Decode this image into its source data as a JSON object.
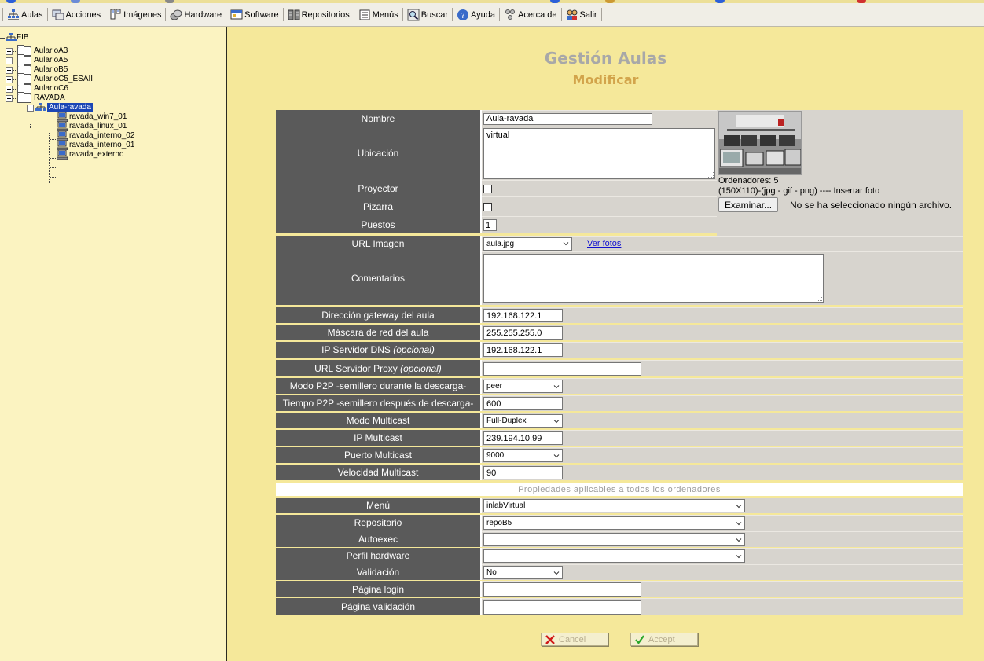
{
  "menubar": {
    "items": [
      {
        "label": "Aulas",
        "icon": "aulas-icon"
      },
      {
        "label": "Acciones",
        "icon": "acciones-icon"
      },
      {
        "label": "Imágenes",
        "icon": "imagenes-icon"
      },
      {
        "label": "Hardware",
        "icon": "hardware-icon"
      },
      {
        "label": "Software",
        "icon": "software-icon"
      },
      {
        "label": "Repositorios",
        "icon": "repositorios-icon"
      },
      {
        "label": "Menús",
        "icon": "menus-icon"
      },
      {
        "label": "Buscar",
        "icon": "buscar-icon"
      },
      {
        "label": "Ayuda",
        "icon": "ayuda-icon"
      },
      {
        "label": "Acerca de",
        "icon": "acerca-icon"
      },
      {
        "label": "Salir",
        "icon": "salir-icon"
      }
    ]
  },
  "tree": {
    "root": "FIB",
    "folders": [
      "AularioA3",
      "AularioA5",
      "AularioB5",
      "AularioC5_ESAII",
      "AularioC6",
      "RAVADA"
    ],
    "selected": "Aula-ravada",
    "computers": [
      "ravada_win7_01",
      "ravada_linux_01",
      "ravada_interno_02",
      "ravada_interno_01",
      "ravada_externo"
    ]
  },
  "header": {
    "title": "Gestión Aulas",
    "subtitle": "Modificar"
  },
  "form": {
    "nombre": {
      "label": "Nombre",
      "value": "Aula-ravada"
    },
    "ubicacion": {
      "label": "Ubicación",
      "value": "virtual"
    },
    "proyector": {
      "label": "Proyector",
      "checked": false
    },
    "pizarra": {
      "label": "Pizarra",
      "checked": false
    },
    "puestos": {
      "label": "Puestos",
      "value": "1"
    },
    "url_imagen": {
      "label": "URL Imagen",
      "value": "aula.jpg",
      "link": "Ver fotos"
    },
    "comentarios": {
      "label": "Comentarios",
      "value": ""
    },
    "gateway": {
      "label": "Dirección gateway del aula",
      "value": "192.168.122.1"
    },
    "mascara": {
      "label": "Máscara de red del aula",
      "value": "255.255.255.0"
    },
    "dns": {
      "label": "IP Servidor DNS",
      "optional": "(opcional)",
      "value": "192.168.122.1"
    },
    "proxy": {
      "label": "URL Servidor Proxy",
      "optional": "(opcional)",
      "value": ""
    },
    "p2p_modo": {
      "label": "Modo P2P -semillero durante la descarga-",
      "value": "peer"
    },
    "p2p_tiempo": {
      "label": "Tiempo P2P -semillero después de descarga-",
      "value": "600"
    },
    "mc_modo": {
      "label": "Modo Multicast",
      "value": "Full-Duplex"
    },
    "mc_ip": {
      "label": "IP Multicast",
      "value": "239.194.10.99"
    },
    "mc_puerto": {
      "label": "Puerto Multicast",
      "value": "9000"
    },
    "mc_velocidad": {
      "label": "Velocidad Multicast",
      "value": "90"
    },
    "section_title": "Propiedades aplicables a todos los ordenadores",
    "menu": {
      "label": "Menú",
      "value": "inlabVirtual"
    },
    "repositorio": {
      "label": "Repositorio",
      "value": "repoB5"
    },
    "autoexec": {
      "label": "Autoexec",
      "value": ""
    },
    "perfil_hw": {
      "label": "Perfil hardware",
      "value": ""
    },
    "validacion": {
      "label": "Validación",
      "value": "No"
    },
    "pagina_login": {
      "label": "Página login",
      "value": ""
    },
    "pagina_validacion": {
      "label": "Página validación",
      "value": ""
    }
  },
  "photo": {
    "ordenadores": "Ordenadores: 5",
    "info": "(150X110)-(jpg - gif - png) ---- Insertar foto",
    "browse": "Examinar...",
    "no_file": "No se ha seleccionado ningún archivo."
  },
  "buttons": {
    "cancel": "Cancel",
    "accept": "Accept"
  }
}
